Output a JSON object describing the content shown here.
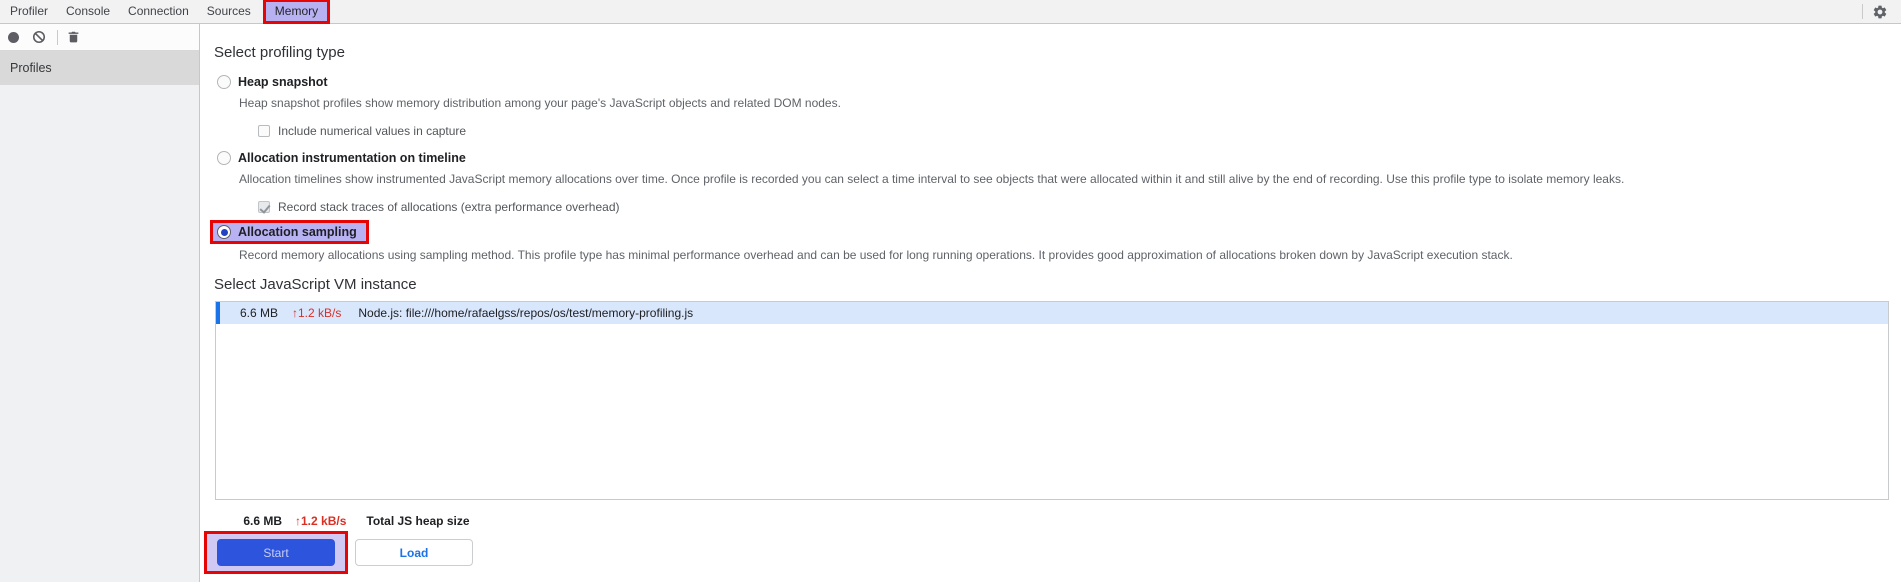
{
  "tabbar": {
    "tabs": [
      {
        "label": "Profiler",
        "selected": false
      },
      {
        "label": "Console",
        "selected": false
      },
      {
        "label": "Connection",
        "selected": false
      },
      {
        "label": "Sources",
        "selected": false
      },
      {
        "label": "Memory",
        "selected": true,
        "annotated": true
      }
    ]
  },
  "sidebar": {
    "toolbar_icons": [
      "record-icon",
      "block-icon",
      "trash-icon"
    ],
    "profiles_label": "Profiles"
  },
  "profiling": {
    "heading": "Select profiling type",
    "options": [
      {
        "label": "Heap snapshot",
        "selected": false,
        "description": "Heap snapshot profiles show memory distribution among your page's JavaScript objects and related DOM nodes.",
        "checkbox": {
          "label": "Include numerical values in capture",
          "checked": false
        }
      },
      {
        "label": "Allocation instrumentation on timeline",
        "selected": false,
        "description": "Allocation timelines show instrumented JavaScript memory allocations over time. Once profile is recorded you can select a time interval to see objects that were allocated within it and still alive by the end of recording. Use this profile type to isolate memory leaks.",
        "checkbox": {
          "label": "Record stack traces of allocations (extra performance overhead)",
          "checked": true
        }
      },
      {
        "label": "Allocation sampling",
        "selected": true,
        "annotated": true,
        "description": "Record memory allocations using sampling method. This profile type has minimal performance overhead and can be used for long running operations. It provides good approximation of allocations broken down by JavaScript execution stack."
      }
    ]
  },
  "vm": {
    "heading": "Select JavaScript VM instance",
    "rows": [
      {
        "size": "6.6 MB",
        "rate": "↑1.2 kB/s",
        "name": "Node.js: file:///home/rafaelgss/repos/os/test/memory-profiling.js",
        "selected": true
      }
    ],
    "total": {
      "size": "6.6 MB",
      "rate": "↑1.2 kB/s",
      "label": "Total JS heap size"
    }
  },
  "actions": {
    "start": "Start",
    "load": "Load"
  },
  "colors": {
    "accent_blue": "#1a73e8",
    "row_selected_bg": "#d9e7fd",
    "rate_red": "#d93025",
    "primary_button_bg": "#2d54dc",
    "annotation_red": "#e60505",
    "highlight_lavender": "#b7b0f1",
    "overlay_lavender": "#cfc9f4"
  }
}
